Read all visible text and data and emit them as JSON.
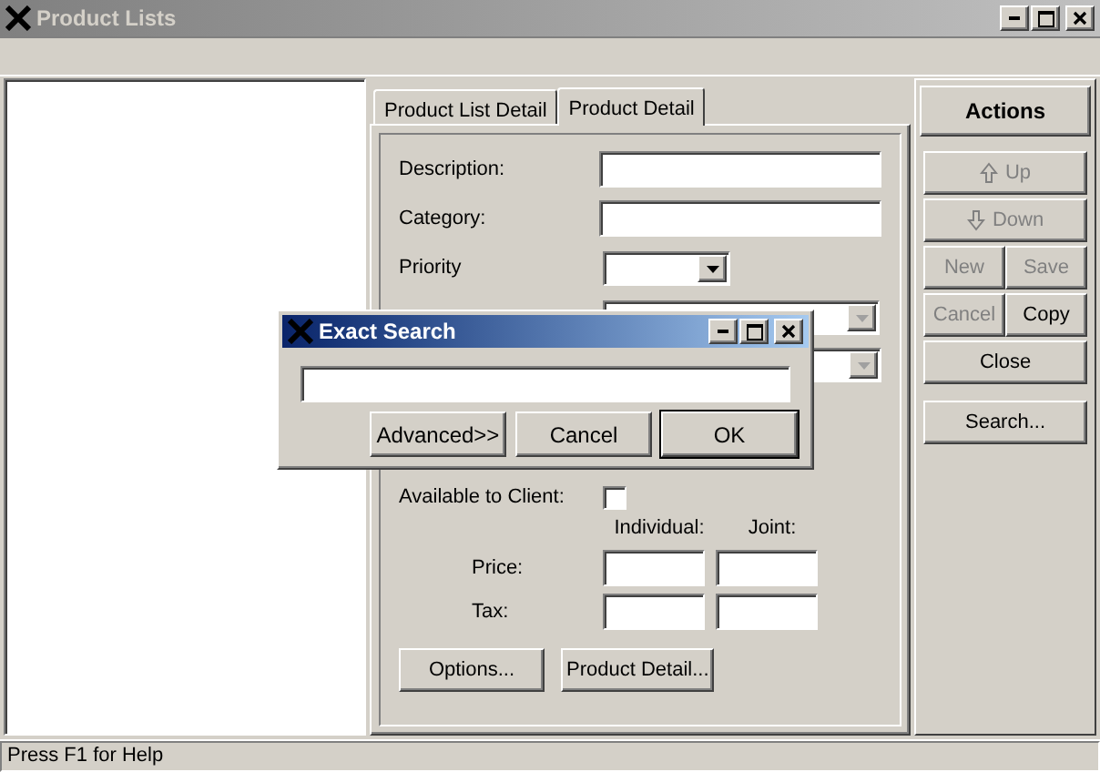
{
  "window": {
    "title": "Product Lists"
  },
  "tabs": [
    {
      "label": "Product List Detail",
      "selected": false
    },
    {
      "label": "Product Detail",
      "selected": true
    }
  ],
  "fields": [
    {
      "kind": "text",
      "label": "Description:"
    },
    {
      "kind": "text",
      "label": "Category:"
    },
    {
      "kind": "dropdown",
      "label": "Priority",
      "disabled": false
    },
    {
      "kind": "dropdown",
      "disabled": true
    },
    {
      "kind": "dropdown",
      "disabled": true
    }
  ],
  "available_to_client": {
    "label": "Available to Client:",
    "checked": false
  },
  "price_table": {
    "columns": [
      "Individual:",
      "Joint:"
    ],
    "rows": [
      "Price:",
      "Tax:"
    ]
  },
  "form_buttons": [
    "Options...",
    "Product Detail..."
  ],
  "actions": {
    "title": "Actions",
    "buttons": [
      {
        "label": "Up",
        "disabled": true
      },
      {
        "label": "Down",
        "disabled": true
      },
      {
        "label": "New",
        "disabled": true
      },
      {
        "label": "Save",
        "disabled": true
      },
      {
        "label": "Cancel",
        "disabled": true
      },
      {
        "label": "Copy",
        "disabled": false
      },
      {
        "label": "Close",
        "disabled": false
      },
      {
        "label": "Search...",
        "disabled": false
      }
    ]
  },
  "dialog": {
    "title": "Exact Search",
    "buttons": [
      {
        "label": "Advanced>>",
        "default": false
      },
      {
        "label": "Cancel",
        "default": false
      },
      {
        "label": "OK",
        "default": true
      }
    ]
  },
  "status_bar": "Press F1 for Help"
}
